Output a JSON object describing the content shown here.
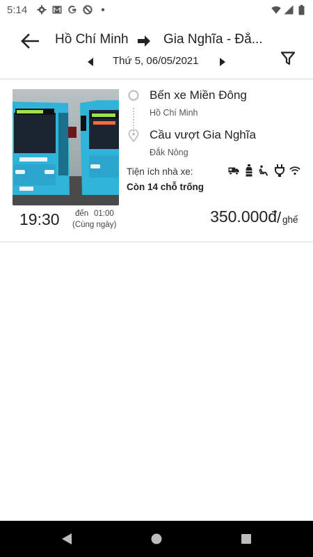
{
  "status_bar": {
    "time": "5:14",
    "left_icons": [
      "gear-icon",
      "gmail-icon",
      "google-icon",
      "lens-icon",
      "dot-icon"
    ],
    "right_icons": [
      "wifi-icon",
      "signal-icon",
      "battery-icon"
    ]
  },
  "header": {
    "route_from": "Hồ Chí Minh",
    "route_to": "Gia Nghĩa - Đắ...",
    "date": "Thứ 5, 06/05/2021"
  },
  "trip": {
    "departure_time": "19:30",
    "arrival_label": "đến",
    "arrival_time": "01:00",
    "arrival_note": "(Cùng ngày)",
    "origin_name": "Bến xe Miền Đông",
    "origin_area": "Hồ Chí Minh",
    "destination_name": "Cầu vượt Gia Nghĩa",
    "destination_area": "Đắk Nông",
    "amenities_label": "Tiện ích nhà xe:",
    "amenities": [
      "truck-icon",
      "water-bottle-icon",
      "reclining-seat-icon",
      "charger-plug-icon",
      "wifi-icon"
    ],
    "seats_text": "Còn  14 chỗ trống",
    "price": "350.000đ",
    "price_sep": "/",
    "price_unit": "ghế"
  },
  "colors": {
    "bus_teal": "#2fb3d9",
    "divider": "#d9d9d9",
    "navbar": "#000000"
  }
}
